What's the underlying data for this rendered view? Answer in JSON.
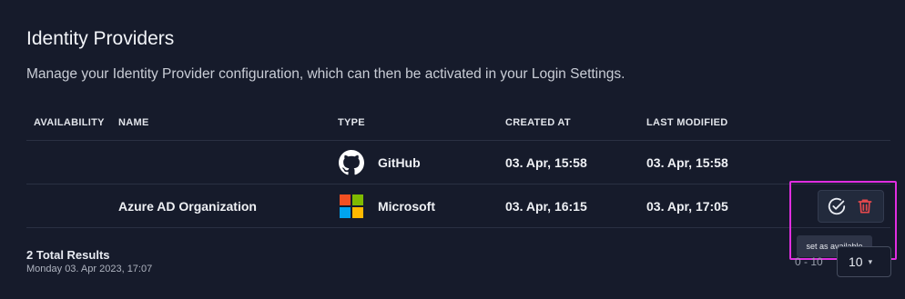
{
  "page": {
    "title": "Identity Providers",
    "description": "Manage your Identity Provider configuration, which can then be activated in your Login Settings."
  },
  "table": {
    "headers": {
      "availability": "AVAILABILITY",
      "name": "NAME",
      "type": "TYPE",
      "created": "CREATED AT",
      "modified": "LAST MODIFIED"
    },
    "rows": [
      {
        "name": "",
        "type": "GitHub",
        "type_icon": "github-icon",
        "created": "03. Apr, 15:58",
        "modified": "03. Apr, 15:58"
      },
      {
        "name": "Azure AD Organization",
        "type": "Microsoft",
        "type_icon": "microsoft-icon",
        "created": "03. Apr, 16:15",
        "modified": "03. Apr, 17:05"
      }
    ]
  },
  "row_actions": {
    "set_available_icon": "check-circle-icon",
    "delete_icon": "trash-icon",
    "tooltip": "set as available"
  },
  "footer": {
    "total_results": "2 Total Results",
    "timestamp": "Monday 03. Apr 2023, 17:07",
    "range": "0 - 10",
    "page_size": "10"
  },
  "colors": {
    "background": "#161b2b",
    "highlight": "#e02ee0",
    "delete": "#e5484d",
    "ms_red": "#f25022",
    "ms_green": "#7fba00",
    "ms_blue": "#00a4ef",
    "ms_yellow": "#ffb900"
  }
}
